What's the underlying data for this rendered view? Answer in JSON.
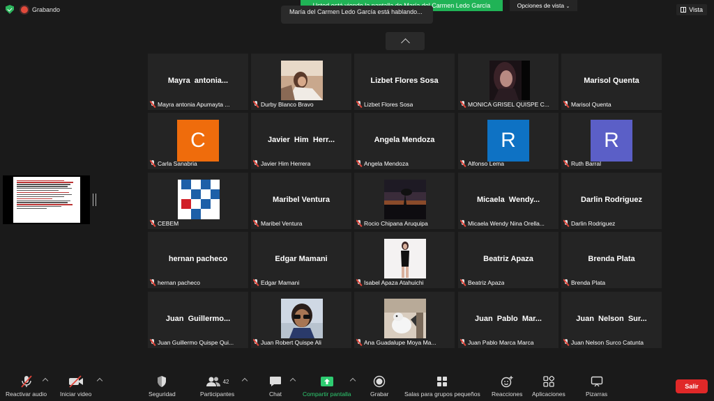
{
  "top": {
    "recording_label": "Grabando",
    "share_banner": "Usted está viendo la pantalla de María del Carmen Ledo García",
    "view_options": "Opciones de vista",
    "talking": "María del Carmen Ledo García está hablando...",
    "view_label": "Vista"
  },
  "colors": {
    "green": "#20b356",
    "red": "#e02828",
    "tile_bg": "#242424"
  },
  "tiles": [
    {
      "big": "Mayra  antonia...",
      "label": "Mayra antonia Apumayta ..."
    },
    {
      "big": "",
      "label": "Durby Blanco Bravo",
      "photo": "photo-reclining"
    },
    {
      "big": "Lizbet Flores Sosa",
      "label": "Lizbet Flores Sosa"
    },
    {
      "big": "",
      "label": "MONICA GRISEL QUISPE C...",
      "photo": "photo-portrait-dark"
    },
    {
      "big": "Marisol Quenta",
      "label": "Marisol Quenta"
    },
    {
      "big": "",
      "label": "Carla Sanabria",
      "avatar": "C",
      "avatar_color": "#ef6c0c"
    },
    {
      "big": "Javier  Him  Herr...",
      "label": "Javier Him Herrera"
    },
    {
      "big": "Angela Mendoza",
      "label": "Angela Mendoza"
    },
    {
      "big": "",
      "label": "Alfonso Lema",
      "avatar": "R",
      "avatar_color": "#0e72c4"
    },
    {
      "big": "",
      "label": "Ruth Barral",
      "avatar": "R",
      "avatar_color": "#5b5fc7"
    },
    {
      "big": "",
      "label": "CEBEM",
      "photo": "logo-cebem"
    },
    {
      "big": "Maribel Ventura",
      "label": "Maribel Ventura"
    },
    {
      "big": "",
      "label": "Rocio Chipana Aruquipa",
      "photo": "photo-sunset"
    },
    {
      "big": "Micaela  Wendy...",
      "label": "Micaela Wendy Nina Orella..."
    },
    {
      "big": "Darlin Rodriguez",
      "label": "Darlin Rodriguez"
    },
    {
      "big": "hernan pacheco",
      "label": "hernan pacheco"
    },
    {
      "big": "Edgar Mamani",
      "label": "Edgar Mamani"
    },
    {
      "big": "",
      "label": "Isabel Apaza Atahuichi",
      "photo": "photo-standing"
    },
    {
      "big": "Beatriz Apaza",
      "label": "Beatriz Apaza"
    },
    {
      "big": "Brenda Plata",
      "label": "Brenda Plata"
    },
    {
      "big": "Juan  Guillermo...",
      "label": "Juan Guillermo Quispe Qui..."
    },
    {
      "big": "",
      "label": "Juan Robert Quispe Ali",
      "photo": "photo-sunglasses"
    },
    {
      "big": "",
      "label": "Ana Guadalupe Moya Ma...",
      "photo": "photo-dog"
    },
    {
      "big": "Juan  Pablo  Mar...",
      "label": "Juan Pablo Marca Marca"
    },
    {
      "big": "Juan  Nelson  Sur...",
      "label": "Juan Nelson Surco Catunta"
    }
  ],
  "toolbar": {
    "unmute": "Reactivar audio",
    "start_video": "Iniciar video",
    "security": "Seguridad",
    "participants": "Participantes",
    "participants_count": "42",
    "chat": "Chat",
    "share": "Compartir pantalla",
    "record": "Grabar",
    "breakout": "Salas para grupos pequeños",
    "reactions": "Reacciones",
    "apps": "Aplicaciones",
    "whiteboards": "Pizarras",
    "leave": "Salir"
  }
}
